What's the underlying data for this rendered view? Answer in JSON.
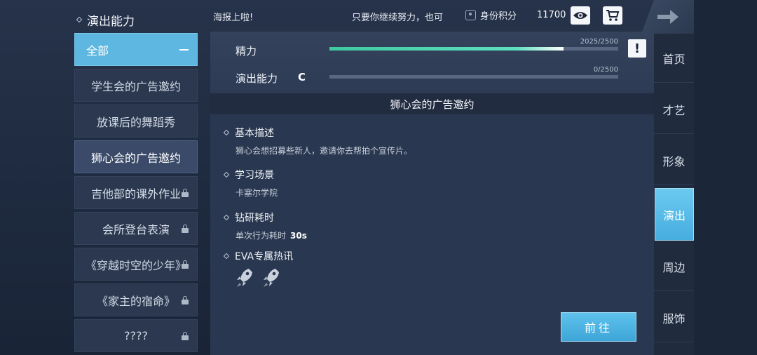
{
  "header": {
    "section_title": "演出能力",
    "ticker_left": "海报上啦!",
    "ticker_right": "只要你继续努力，也可",
    "score_label": "身份积分",
    "score_value": "11700"
  },
  "left_list": {
    "items": [
      {
        "label": "全部"
      },
      {
        "label": "学生会的广告邀约"
      },
      {
        "label": "放课后的舞蹈秀"
      },
      {
        "label": "狮心会的广告邀约"
      },
      {
        "label": "吉他部的课外作业"
      },
      {
        "label": "会所登台表演"
      },
      {
        "label": "《穿越时空的少年》"
      },
      {
        "label": "《家主的宿命》"
      },
      {
        "label": "????"
      }
    ]
  },
  "stats": {
    "stamina_label": "精力",
    "stamina_current": 2025,
    "stamina_max": 2500,
    "stamina_text": "2025/2500",
    "perform_label": "演出能力",
    "perform_grade": "C",
    "perform_current": 0,
    "perform_max": 2500,
    "perform_text": "0/2500",
    "alert_symbol": "!"
  },
  "detail": {
    "title": "狮心会的广告邀约",
    "desc_title": "基本描述",
    "desc_text": "狮心会想招募些新人，邀请你去帮拍个宣传片。",
    "scene_title": "学习场景",
    "scene_text": "卡塞尔学院",
    "time_title": "钻研耗时",
    "time_text": "单次行为耗时",
    "time_value": "30s",
    "eva_title": "EVA专属热讯",
    "go_label": "前往"
  },
  "tabs": [
    {
      "label": "首页"
    },
    {
      "label": "才艺"
    },
    {
      "label": "形象"
    },
    {
      "label": "演出"
    },
    {
      "label": "周边"
    },
    {
      "label": "服饰"
    }
  ],
  "colors": {
    "accent": "#5eb7e0",
    "stamina_bar": "#3fc9a0",
    "panel": "#2a3750"
  },
  "icons": [
    "eye-icon",
    "cart-icon",
    "back-arrow-icon",
    "lock-icon",
    "rocket-icon",
    "alert-icon",
    "badge-icon"
  ]
}
